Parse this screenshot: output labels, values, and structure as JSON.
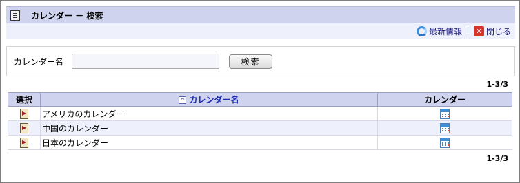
{
  "header": {
    "title": "カレンダー － 検索",
    "icon": "document-icon"
  },
  "toolbar": {
    "refresh_label": "最新情報",
    "close_label": "閉じる",
    "close_glyph": "✕"
  },
  "search": {
    "label": "カレンダー名",
    "value": "",
    "placeholder": "",
    "button_label": "検索"
  },
  "pager": {
    "top": "1-3/3",
    "bottom": "1-3/3"
  },
  "table": {
    "columns": {
      "select": "選択",
      "name": "カレンダー名",
      "calendar": "カレンダー"
    },
    "sort_glyph": "^",
    "rows": [
      {
        "name": "アメリカのカレンダー"
      },
      {
        "name": "中国のカレンダー"
      },
      {
        "name": "日本のカレンダー"
      }
    ]
  },
  "colors": {
    "header_bg": "#cfd3ee",
    "toolbar_bg": "#eef0fb",
    "link": "#1b2bb8"
  }
}
